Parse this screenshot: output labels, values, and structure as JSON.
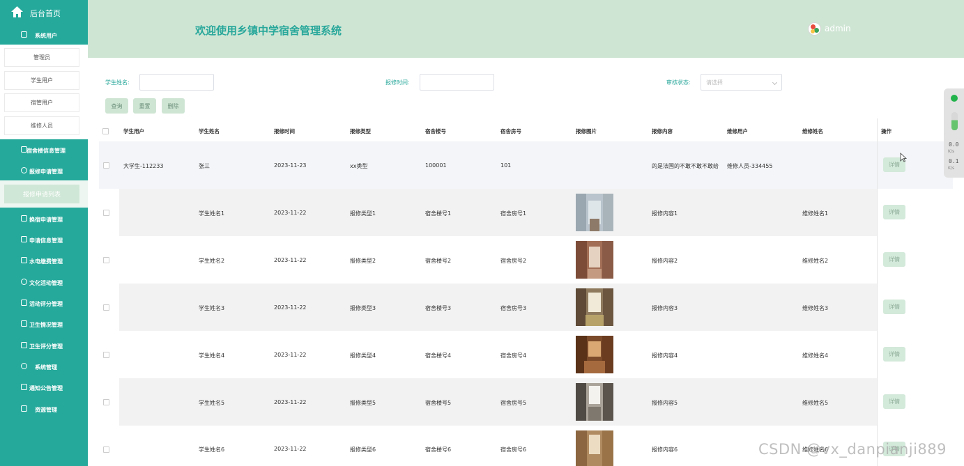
{
  "sidebar": {
    "home": "后台首页",
    "groups": [
      {
        "label": "系统用户",
        "sub": [
          "管理员",
          "学生用户",
          "宿管用户",
          "维修人员"
        ]
      },
      {
        "label": "宿舍楼信息管理"
      },
      {
        "label": "报修申请管理",
        "active": "报修申请列表"
      },
      {
        "label": "换宿申请管理"
      },
      {
        "label": "申请信息管理"
      },
      {
        "label": "水电缴费管理"
      },
      {
        "label": "文化活动管理"
      },
      {
        "label": "活动评分管理"
      },
      {
        "label": "卫生情况管理"
      },
      {
        "label": "卫生评分管理"
      },
      {
        "label": "系统管理"
      },
      {
        "label": "通知公告管理"
      },
      {
        "label": "资源管理"
      }
    ]
  },
  "header": {
    "title": "欢迎使用乡镇中学宿舍管理系统",
    "user": "admin"
  },
  "filters": {
    "student_name_label": "学生姓名:",
    "repair_time_label": "报修时间:",
    "status_label": "审核状态:",
    "status_placeholder": "请选择",
    "buttons": [
      "查询",
      "重置",
      "删除"
    ]
  },
  "table": {
    "columns": [
      "学生用户",
      "学生姓名",
      "报修时间",
      "报修类型",
      "宿舍楼号",
      "宿舍房号",
      "报修图片",
      "报修内容",
      "维修用户",
      "维修姓名",
      "操作"
    ],
    "rows": [
      {
        "user": "大学生-112233",
        "name": "张三",
        "time": "2023-11-23",
        "type": "xx类型",
        "building": "100001",
        "room": "101",
        "content": "的是法国的不敢不敢不敢给",
        "repair_user": "维修人员-334455",
        "repair_name": "",
        "action": "详情"
      },
      {
        "user": "",
        "name": "学生姓名1",
        "time": "2023-11-22",
        "type": "报修类型1",
        "building": "宿舍楼号1",
        "room": "宿舍房号1",
        "content": "报修内容1",
        "repair_user": "",
        "repair_name": "维修姓名1",
        "action": "详情"
      },
      {
        "user": "",
        "name": "学生姓名2",
        "time": "2023-11-22",
        "type": "报修类型2",
        "building": "宿舍楼号2",
        "room": "宿舍房号2",
        "content": "报修内容2",
        "repair_user": "",
        "repair_name": "维修姓名2",
        "action": "详情"
      },
      {
        "user": "",
        "name": "学生姓名3",
        "time": "2023-11-22",
        "type": "报修类型3",
        "building": "宿舍楼号3",
        "room": "宿舍房号3",
        "content": "报修内容3",
        "repair_user": "",
        "repair_name": "维修姓名3",
        "action": "详情"
      },
      {
        "user": "",
        "name": "学生姓名4",
        "time": "2023-11-22",
        "type": "报修类型4",
        "building": "宿舍楼号4",
        "room": "宿舍房号4",
        "content": "报修内容4",
        "repair_user": "",
        "repair_name": "维修姓名4",
        "action": "详情"
      },
      {
        "user": "",
        "name": "学生姓名5",
        "time": "2023-11-22",
        "type": "报修类型5",
        "building": "宿舍楼号5",
        "room": "宿舍房号5",
        "content": "报修内容5",
        "repair_user": "",
        "repair_name": "维修姓名5",
        "action": "详情"
      },
      {
        "user": "",
        "name": "学生姓名6",
        "time": "2023-11-22",
        "type": "报修类型6",
        "building": "宿舍楼号6",
        "room": "宿舍房号6",
        "content": "报修内容6",
        "repair_user": "",
        "repair_name": "维修姓名6",
        "action": "详情"
      }
    ]
  },
  "widget": {
    "down": "0.0",
    "up": "0.1",
    "unit": "K/s"
  },
  "watermark": "CSDN @vx_danpianji889",
  "colors": {
    "sidebar": "#25a99b",
    "header": "#cfe5d4",
    "accent": "#27a79a"
  }
}
